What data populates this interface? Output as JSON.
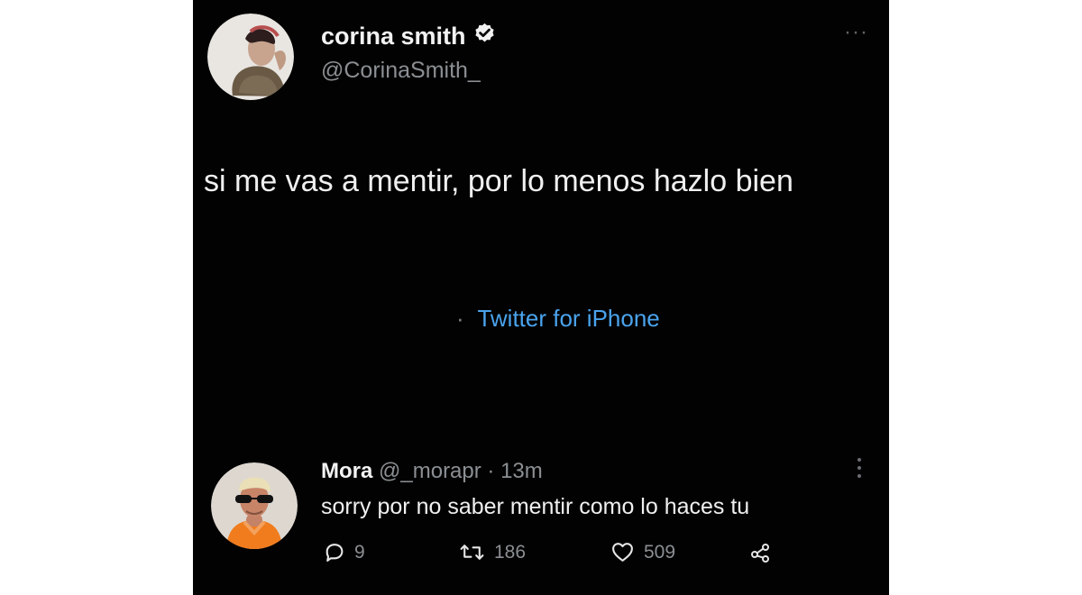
{
  "tweet": {
    "display_name": "corina smith",
    "handle": "@CorinaSmith_",
    "more_label": "···",
    "text": "si me vas a mentir, por lo menos hazlo bien",
    "source_separator": "·",
    "source": "Twitter for iPhone",
    "verified": true
  },
  "reply": {
    "name": "Mora",
    "meta": "@_morapr · 13m",
    "text": "sorry por no saber mentir como lo haces tu",
    "stats": {
      "replies": "9",
      "retweets": "186",
      "likes": "509"
    }
  },
  "icons": {
    "verified": "verified-badge-icon",
    "reply": "speech-bubble-icon",
    "retweet": "retweet-icon",
    "like": "heart-icon",
    "share": "share-icon",
    "more": "more-options-icon"
  },
  "colors": {
    "background": "#020202",
    "text": "#f0f0f0",
    "muted": "#8b8f93",
    "source_link": "#4aa3ed"
  }
}
